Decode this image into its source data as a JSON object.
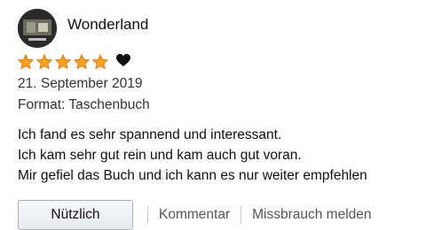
{
  "review": {
    "username": "Wonderland",
    "rating": 5,
    "rating_max": 5,
    "badge_icon": "heart-icon",
    "date": "21. September 2019",
    "format": "Format: Taschenbuch",
    "body_lines": [
      "Ich fand es sehr spannend und interessant.",
      "Ich kam sehr gut rein und kam auch gut voran.",
      "Mir gefiel das Buch und ich kann es nur weiter empfehlen"
    ]
  },
  "actions": {
    "helpful_label": "Nützlich",
    "comment_label": "Kommentar",
    "report_label": "Missbrauch melden"
  },
  "colors": {
    "star": "#ffa41c",
    "star_stroke": "#de7921",
    "heart": "#111111",
    "secondary_text": "#555555"
  }
}
